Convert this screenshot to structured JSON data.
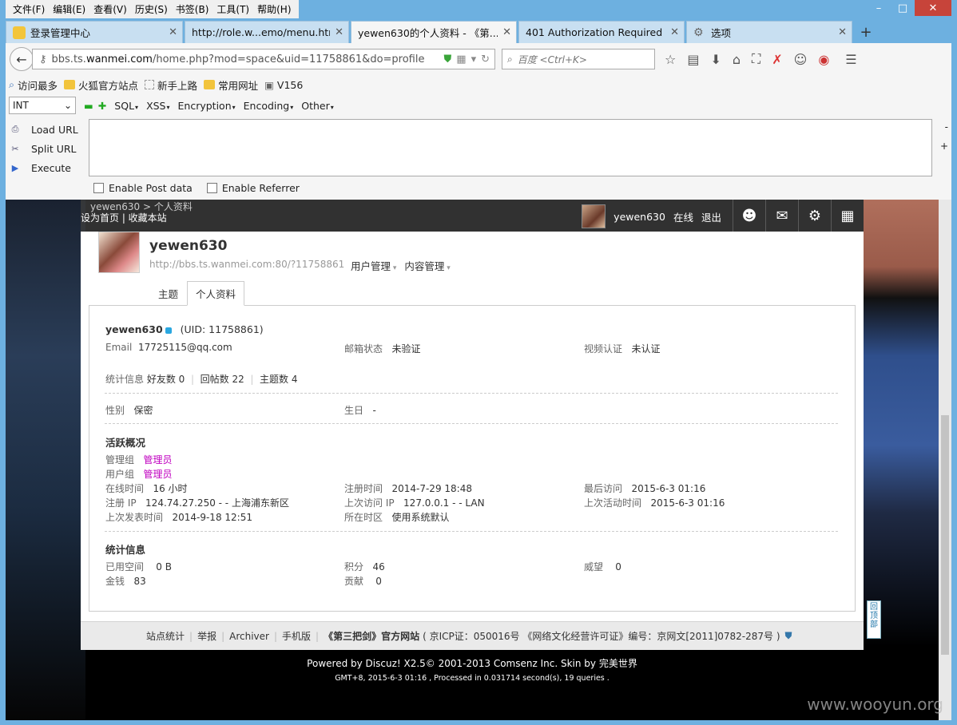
{
  "menubar": [
    "文件(F)",
    "编辑(E)",
    "查看(V)",
    "历史(S)",
    "书签(B)",
    "工具(T)",
    "帮助(H)"
  ],
  "tabs": [
    {
      "title": "登录管理中心"
    },
    {
      "title": "http://role.w...emo/menu.htm"
    },
    {
      "title": "yewen630的个人资料 - 《第..."
    },
    {
      "title": "401 Authorization Required"
    },
    {
      "title": "选项"
    }
  ],
  "nav": {
    "url_prefix": "bbs.ts.",
    "url_host": "wanmei.com",
    "url_path": "/home.php?mod=space&uid=11758861&do=profile",
    "search_placeholder": "百度 <Ctrl+K>"
  },
  "bookmarks": [
    "访问最多",
    "火狐官方站点",
    "新手上路",
    "常用网址",
    "V156"
  ],
  "hackbar": {
    "select_value": "INT",
    "menus": [
      "SQL",
      "XSS",
      "Encryption",
      "Encoding",
      "Other"
    ],
    "actions": [
      "Load URL",
      "Split URL",
      "Execute"
    ],
    "checks": [
      "Enable Post data",
      "Enable Referrer"
    ]
  },
  "dz": {
    "links": "设为首页 | 收藏本站",
    "breadcrumb": "yewen630  >  个人资料",
    "username_top": "yewen630",
    "online": "在线",
    "logout": "退出"
  },
  "profile": {
    "name": "yewen630",
    "url": "http://bbs.ts.wanmei.com:80/?11758861",
    "menu_user": "用户管理",
    "menu_content": "内容管理",
    "tab_topics": "主题",
    "tab_profile": "个人资料",
    "uid_line": "(UID: 11758861)",
    "email_label": "Email",
    "email": "17725115@qq.com",
    "email_status_label": "邮箱状态",
    "email_status": "未验证",
    "video_label": "视频认证",
    "video": "未认证",
    "stats_label": "统计信息",
    "friends": "好友数 0",
    "replies": "回帖数 22",
    "threads": "主题数 4",
    "gender_label": "性别",
    "gender": "保密",
    "birthday_label": "生日",
    "birthday": "-",
    "activity_title": "活跃概况",
    "admin_group_label": "管理组",
    "admin_group": "管理员",
    "user_group_label": "用户组",
    "user_group": "管理员",
    "online_time_label": "在线时间",
    "online_time": "16 小时",
    "reg_time_label": "注册时间",
    "reg_time": "2014-7-29 18:48",
    "last_visit_label": "最后访问",
    "last_visit": "2015-6-3 01:16",
    "reg_ip_label": "注册 IP",
    "reg_ip": "124.74.27.250 - - 上海浦东新区",
    "last_ip_label": "上次访问 IP",
    "last_ip": "127.0.0.1 - - LAN",
    "last_active_label": "上次活动时间",
    "last_active": "2015-6-3 01:16",
    "last_post_label": "上次发表时间",
    "last_post": "2014-9-18 12:51",
    "tz_label": "所在时区",
    "tz": "使用系统默认",
    "stat_title": "统计信息",
    "space_label": "已用空间",
    "space": "0 B",
    "credits_label": "积分",
    "credits": "46",
    "prestige_label": "威望",
    "prestige": "0",
    "money_label": "金钱",
    "money": "83",
    "contrib_label": "贡献",
    "contrib": "0"
  },
  "footer": {
    "links": [
      "站点统计",
      "举报",
      "Archiver",
      "手机版"
    ],
    "site": "《第三把剑》官方网站",
    "icp": "( 京ICP证：050016号 《网络文化经营许可证》编号：京网文[2011]0782-287号 )",
    "powered": "Powered by Discuz! X2.5© 2001-2013 Comsenz Inc.  Skin by 完美世界",
    "processed": "GMT+8, 2015-6-3 01:16 , Processed in 0.031714 second(s), 19 queries .",
    "backtop": "回顶部"
  },
  "watermark": "www.wooyun.org"
}
